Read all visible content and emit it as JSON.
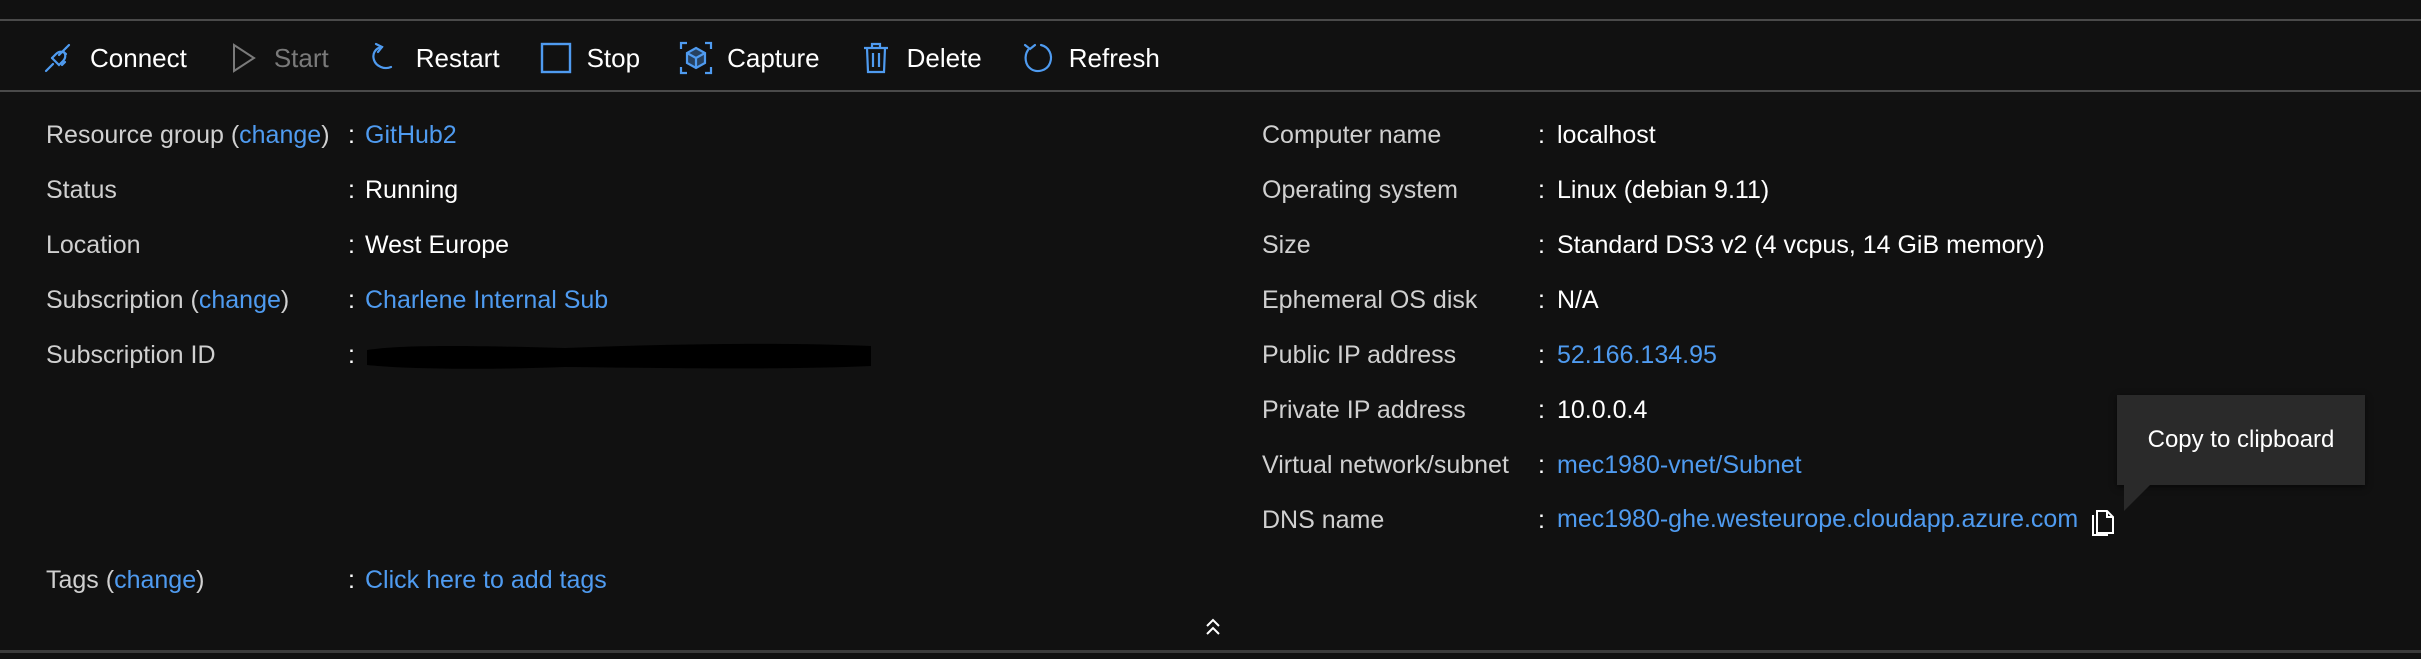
{
  "toolbar": {
    "connect": "Connect",
    "start": "Start",
    "restart": "Restart",
    "stop": "Stop",
    "capture": "Capture",
    "delete": "Delete",
    "refresh": "Refresh"
  },
  "essentials": {
    "left": {
      "resource_group": {
        "label_pre": "Resource group (",
        "change": "change",
        "label_post": ")",
        "value": "GitHub2"
      },
      "status": {
        "label": "Status",
        "value": "Running"
      },
      "location": {
        "label": "Location",
        "value": "West Europe"
      },
      "subscription": {
        "label_pre": "Subscription (",
        "change": "change",
        "label_post": ")",
        "value": "Charlene Internal Sub"
      },
      "subscription_id": {
        "label": "Subscription ID"
      }
    },
    "right": {
      "computer_name": {
        "label": "Computer name",
        "value": "localhost"
      },
      "operating_system": {
        "label": "Operating system",
        "value": "Linux (debian 9.11)"
      },
      "size": {
        "label": "Size",
        "value": "Standard DS3 v2 (4 vcpus, 14 GiB memory)"
      },
      "ephemeral_os_disk": {
        "label": "Ephemeral OS disk",
        "value": "N/A"
      },
      "public_ip": {
        "label": "Public IP address",
        "value": "52.166.134.95"
      },
      "private_ip": {
        "label": "Private IP address",
        "value": "10.0.0.4"
      },
      "vnet_subnet": {
        "label": "Virtual network/subnet",
        "value": "mec1980-vnet/Subnet"
      },
      "dns_name": {
        "label": "DNS name",
        "value": "mec1980-ghe.westeurope.cloudapp.azure.com"
      }
    },
    "tags": {
      "label_pre": "Tags (",
      "change": "change",
      "label_post": ")",
      "value": "Click here to add tags"
    }
  },
  "tooltip": {
    "text": "Copy to clipboard"
  },
  "colors": {
    "accent": "#4f9bf0",
    "background": "#111111",
    "text": "#ffffff",
    "label": "#d0d0d0",
    "disabled": "#7a7a7a"
  }
}
